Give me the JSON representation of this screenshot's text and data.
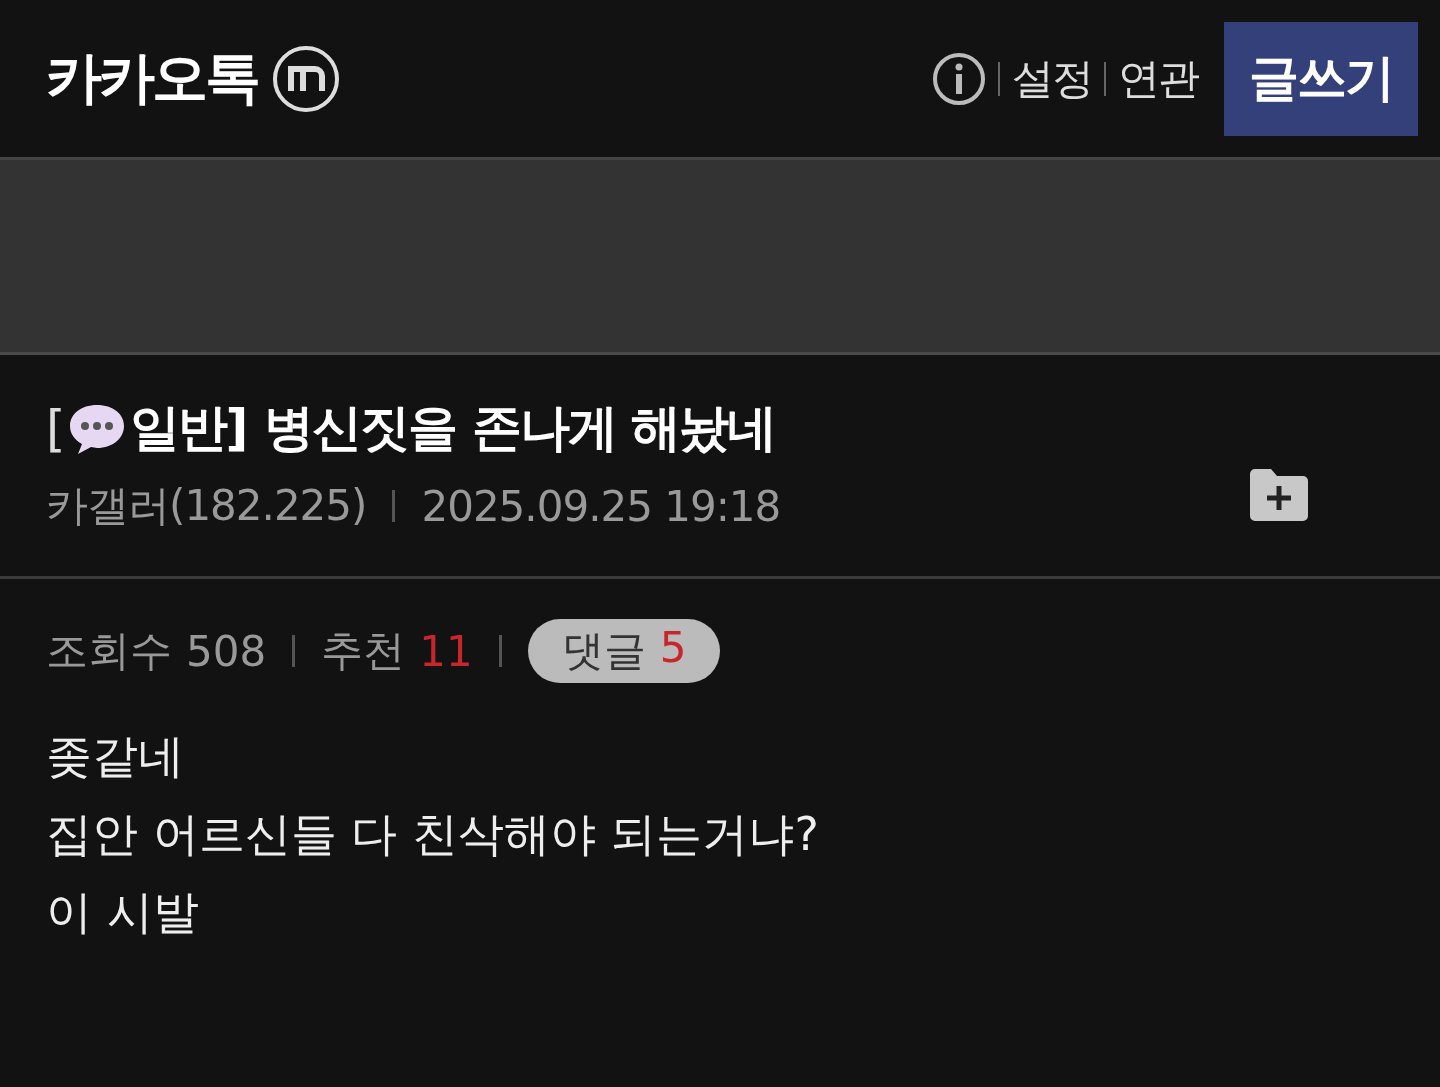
{
  "header": {
    "logo": "카카오톡",
    "nav": [
      "설정",
      "연관"
    ],
    "write_button": "글쓰기"
  },
  "post": {
    "bracket_open": "[",
    "category": "일반]",
    "title": "병신짓을 존나게 해놨네",
    "author": "카갤러(182.225)",
    "date": "2025.09.25 19:18"
  },
  "stats": [
    {
      "kind": "plain",
      "label": "조회수",
      "value": "508"
    },
    {
      "kind": "plain",
      "label": "추천",
      "value": "11"
    },
    {
      "kind": "pill",
      "label": "댓글",
      "value": "5"
    }
  ],
  "body": [
    "좆같네",
    "집안 어르신들 다 친삭해야 되는거냐?",
    "이 시발"
  ]
}
